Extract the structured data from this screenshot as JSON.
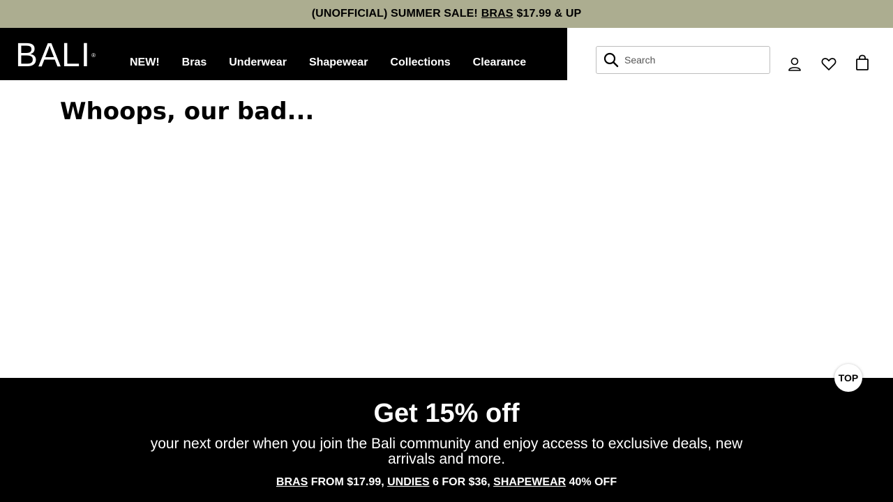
{
  "promo": {
    "prefix": "(UNOFFICIAL) SUMMER SALE!",
    "link": "BRAS",
    "suffix": "$17.99 & UP"
  },
  "header": {
    "logo": "BALI",
    "logo_mark": "®",
    "nav": [
      "NEW!",
      "Bras",
      "Underwear",
      "Shapewear",
      "Collections",
      "Clearance"
    ],
    "search_placeholder": "Search"
  },
  "main": {
    "title": "Whoops, our bad..."
  },
  "footer": {
    "heading": "Get 15% off",
    "subtext": "your next order when you join the Bali community and enjoy access to exclusive deals, new arrivals and more.",
    "deals": {
      "bras_link": "BRAS",
      "bras_text": "FROM $17.99,",
      "undies_link": "UNDIES",
      "undies_text": "6 FOR $36,",
      "shapewear_link": "SHAPEWEAR",
      "shapewear_text": "40% OFF"
    }
  },
  "top_button": "TOP",
  "icons": {
    "search": "search-icon",
    "account": "user-icon",
    "wishlist": "heart-icon",
    "bag": "shopping-bag-icon"
  },
  "colors": {
    "promo_bg": "#acad90",
    "nav_bg": "#000000",
    "footer_bg": "#000000"
  }
}
